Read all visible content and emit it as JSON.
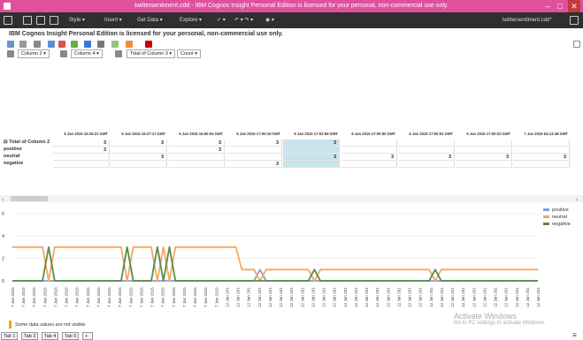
{
  "window": {
    "title": "twittersentiment.cdd - IBM Cognos Insight Personal Edition is licensed for your personal, non-commercial use only."
  },
  "menu": {
    "style": "Style ▾",
    "insert": "Insert ▾",
    "get_data": "Get Data ▾",
    "explore": "Explore ▾",
    "file_name": "twittersentiment.cdd*"
  },
  "notice": "IBM Cognos Insight Personal Edition is licensed for your personal, non-commercial use only.",
  "toolbar2": {
    "column_dd": "Column 2 ▾",
    "column4_dd": "Column 4 ▾",
    "total_dd": "Total of Column 3 ▾",
    "count_dd": "Count ▾"
  },
  "table": {
    "columns": [
      "6 Jan 2015 15:26:21 GMT",
      "6 Jan 2015 15:27:17 GMT",
      "6 Jan 2015 16:50:04 GMT",
      "6 Jan 2015 17:00:19 GMT",
      "6 Jan 2015 17:02:56 GMT",
      "6 Jan 2015 17:00:50 GMT",
      "6 Jan 2015 17:00:01 GMT",
      "6 Jan 2015 17:00:02 GMT",
      "7 Jan 2015 04:14:48 GMT"
    ],
    "rows": [
      {
        "label": "⊟ Total of Column 2",
        "cells": [
          "3",
          "3",
          "3",
          "3",
          "3",
          "",
          "",
          "",
          ""
        ]
      },
      {
        "label": "positive",
        "cells": [
          "3",
          "",
          "3",
          "",
          "",
          "",
          "",
          "",
          ""
        ]
      },
      {
        "label": "neutral",
        "cells": [
          "",
          "3",
          "",
          "",
          "3",
          "3",
          "3",
          "3",
          "3"
        ]
      },
      {
        "label": "negative",
        "cells": [
          "",
          "",
          "",
          "3",
          "",
          "",
          "",
          "",
          ""
        ]
      }
    ]
  },
  "chart_data": {
    "type": "line",
    "yticks": [
      "0",
      "2",
      "4",
      "6"
    ],
    "ylim": [
      0,
      7
    ],
    "series": [
      {
        "name": "positive",
        "color": "#8a9bd8",
        "values": [
          0,
          0,
          0,
          0,
          0,
          0,
          0,
          0,
          0,
          0,
          0,
          0,
          0,
          0,
          0,
          0,
          0,
          0,
          0,
          0,
          0,
          0,
          0,
          0,
          0,
          0,
          0,
          0,
          0,
          0,
          0,
          0,
          0,
          0,
          0,
          0,
          0,
          0,
          0,
          0,
          0,
          1,
          0,
          0,
          0,
          0,
          0,
          0,
          0,
          0,
          0,
          0,
          0,
          0,
          0,
          0,
          0,
          0,
          0,
          0,
          0,
          0,
          0,
          0,
          0,
          0,
          0,
          0,
          0,
          0,
          0,
          0,
          0,
          0,
          0,
          0,
          0,
          0,
          0,
          0,
          0,
          0,
          0,
          0,
          0,
          0,
          0,
          0
        ]
      },
      {
        "name": "neutral",
        "color": "#f5a95c",
        "values": [
          3,
          3,
          3,
          3,
          3,
          3,
          0,
          3,
          3,
          3,
          3,
          3,
          3,
          3,
          3,
          3,
          3,
          3,
          3,
          0,
          3,
          3,
          3,
          3,
          0,
          3,
          0,
          3,
          3,
          3,
          3,
          3,
          3,
          3,
          3,
          3,
          3,
          3,
          1,
          1,
          1,
          0,
          1,
          1,
          1,
          1,
          1,
          1,
          1,
          1,
          0,
          1,
          1,
          1,
          1,
          1,
          1,
          1,
          1,
          1,
          1,
          1,
          1,
          1,
          1,
          1,
          1,
          1,
          1,
          1,
          0,
          1,
          1,
          1,
          1,
          1,
          1,
          1,
          1,
          1,
          1,
          1,
          1,
          1,
          1,
          1,
          1,
          1
        ]
      },
      {
        "name": "negative",
        "color": "#5c8a4c",
        "values": [
          0,
          0,
          0,
          0,
          0,
          0,
          3,
          0,
          0,
          0,
          0,
          0,
          0,
          0,
          0,
          0,
          0,
          0,
          0,
          3,
          0,
          0,
          0,
          0,
          3,
          0,
          3,
          0,
          0,
          0,
          0,
          0,
          0,
          0,
          0,
          0,
          0,
          0,
          0,
          0,
          0,
          0,
          0,
          0,
          0,
          0,
          0,
          0,
          0,
          0,
          1,
          0,
          0,
          0,
          0,
          0,
          0,
          0,
          0,
          0,
          0,
          0,
          0,
          0,
          0,
          0,
          0,
          0,
          0,
          0,
          1,
          0,
          0,
          0,
          0,
          0,
          0,
          0,
          0,
          0,
          0,
          0,
          0,
          0,
          0,
          0,
          0,
          0
        ]
      }
    ],
    "xticks": [
      "7 Jan 2015",
      "7 Jan 2015",
      "7 Jan 2015",
      "7 Jan 2015",
      "7 Jan 2015",
      "7 Jan 2015",
      "7 Jan 2015",
      "7 Jan 2015",
      "7 Jan 2015",
      "7 Jan 2015",
      "7 Jan 2015",
      "7 Jan 2015",
      "7 Jan 2015",
      "7 Jan 2015",
      "7 Jan 2015",
      "7 Jan 2015",
      "7 Jan 2015",
      "7 Jan 2015",
      "7 Jan 2015",
      "7 Jan 2015",
      "12 Jan 201",
      "12 Jan 201",
      "12 Jan 201",
      "12 Jan 201",
      "12 Jan 201",
      "12 Jan 201",
      "12 Jan 201",
      "12 Jan 201",
      "12 Jan 201",
      "12 Jan 201",
      "12 Jan 201",
      "12 Jan 201",
      "12 Jan 201",
      "12 Jan 201",
      "12 Jan 201",
      "12 Jan 201",
      "12 Jan 201",
      "12 Jan 201",
      "12 Jan 201",
      "12 Jan 201",
      "12 Jan 201",
      "12 Jan 201",
      "12 Jan 201",
      "12 Jan 201",
      "12 Jan 201",
      "12 Jan 201",
      "12 Jan 201",
      "12 Jan 201",
      "12 Jan 201",
      "12 Jan 201"
    ]
  },
  "warning": "Some data values are not visible",
  "watermark": {
    "title": "Activate Windows",
    "sub": "Go to PC settings to activate Windows."
  },
  "tabs": [
    "Tab 1",
    "Tab 2",
    "Tab 4",
    "Tab 5"
  ]
}
